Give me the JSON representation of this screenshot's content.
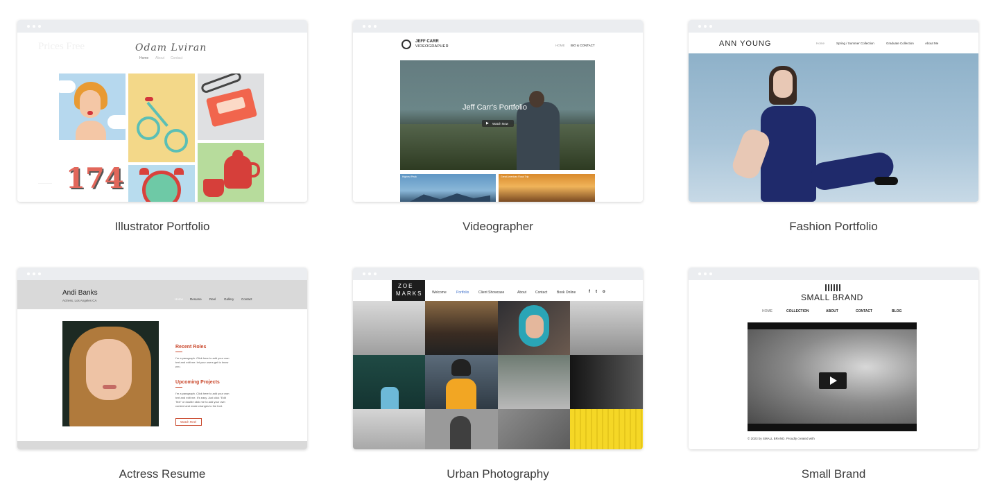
{
  "templates": [
    {
      "caption": "Illustrator Portfolio",
      "brand": "Odam Lviran",
      "nav": [
        "Home",
        "About",
        "Contact"
      ],
      "watermark": "Prices Free",
      "tile_number": "174"
    },
    {
      "caption": "Videographer",
      "logo_line1": "JEFF CARR",
      "logo_line2": "VIDEOGRAPHER",
      "nav": [
        "HOME",
        "BIO & CONTACT"
      ],
      "hero_title": "Jeff Carr's Portfolio",
      "watch_button": "Watch Now",
      "thumb1_label": "Highest Peak",
      "thumb2_label": "Great American Road Trip"
    },
    {
      "caption": "Fashion Portfolio",
      "brand": "ANN YOUNG",
      "nav": [
        "Home",
        "Spring / Summer Collection",
        "Graduate Collection",
        "About Me"
      ]
    },
    {
      "caption": "Actress Resume",
      "name": "Andi Banks",
      "subtitle": "Actress, Los Angeles CA",
      "nav": [
        "Home",
        "Resume",
        "Reel",
        "Gallery",
        "Contact"
      ],
      "recent_roles_title": "Recent Roles",
      "recent_roles_text": "I'm a paragraph. Click here to add your own text and edit me. let your users get to know you.",
      "upcoming_title": "Upcoming Projects",
      "upcoming_text": "I'm a paragraph. Click here to add your own text and edit me. It's easy. Just click \"Edit Text\" or double click me to add your own content and make changes to the font.",
      "watch_reel": "Watch Reel"
    },
    {
      "caption": "Urban Photography",
      "logo_line1": "ZOE",
      "logo_line2": "MARKS",
      "nav": [
        "Welcome",
        "Portfolio",
        "Client Showcase",
        "About",
        "Contact",
        "Book Online"
      ],
      "social": [
        "f",
        "t",
        "o"
      ]
    },
    {
      "caption": "Small Brand",
      "brand": "SMALL BRAND",
      "nav": [
        "HOME",
        "COLLECTION",
        "ABOUT",
        "CONTACT",
        "BLOG"
      ],
      "footer": "© 2023 by SMALL BRAND. Proudly created with"
    }
  ],
  "colors": {
    "chrome": "#ebedf0",
    "actress_accent": "#c9472b",
    "zoe_active": "#3c6ec9"
  }
}
